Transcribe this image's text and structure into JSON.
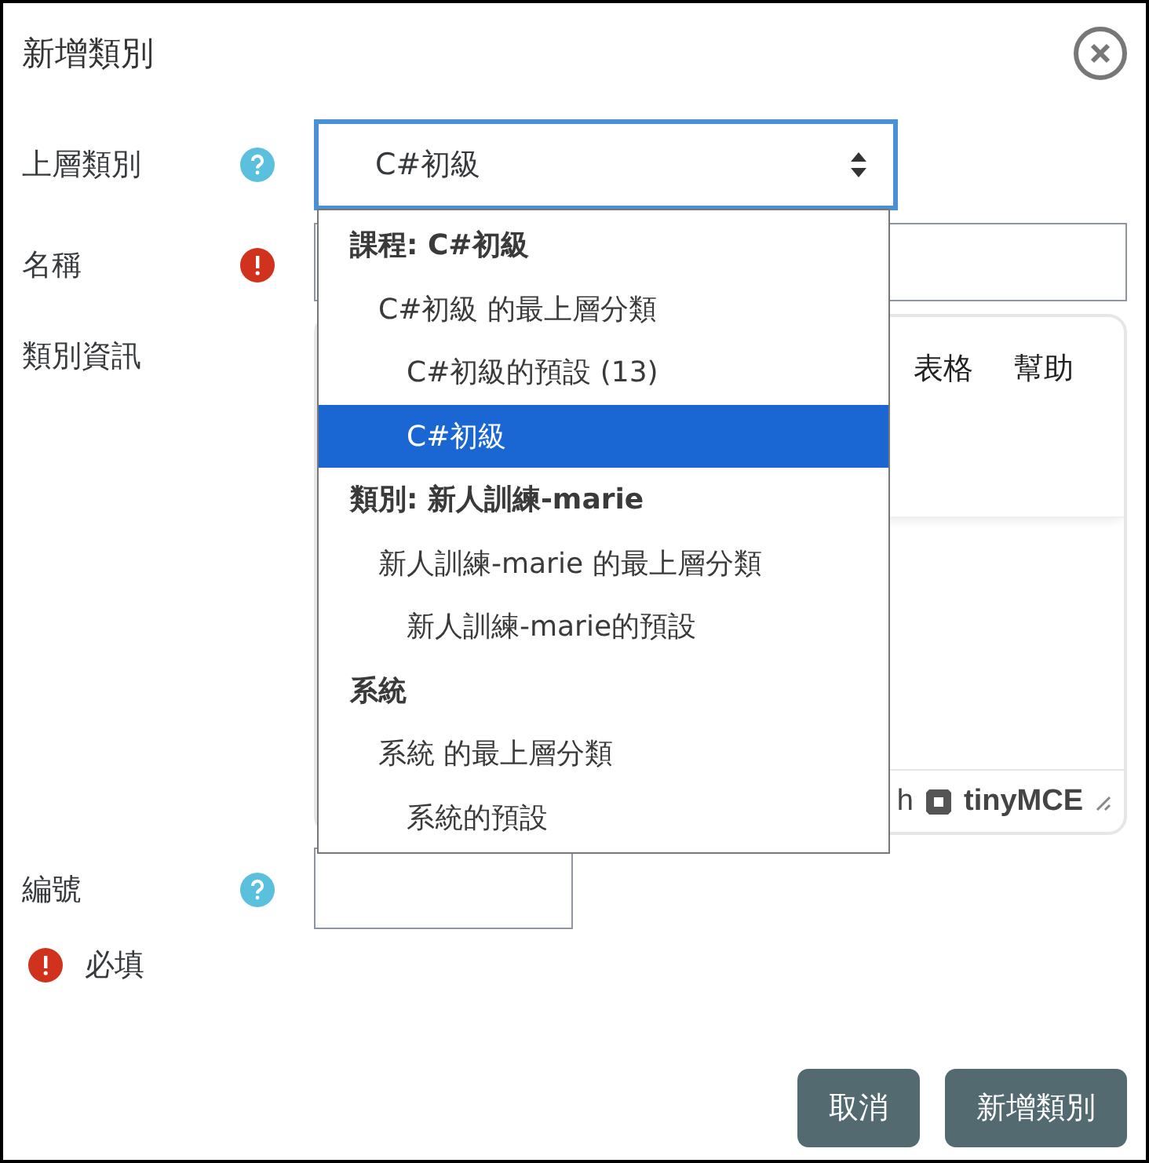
{
  "dialog": {
    "title": "新增類別"
  },
  "fields": [
    {
      "label": "上層類別",
      "hint": {
        "kind": "help"
      },
      "kind": "select",
      "value": "C#初級",
      "focused": true
    },
    {
      "label": "名稱",
      "hint": {
        "kind": "required"
      },
      "kind": "text"
    },
    {
      "label": "類別資訊",
      "kind": "editor"
    },
    {
      "label": "編號",
      "hint": {
        "kind": "help"
      },
      "kind": "number"
    }
  ],
  "editor": {
    "menu": [
      "表格",
      "幫助"
    ],
    "footer_text": "h",
    "brand": "tinyMCE"
  },
  "dropdown": {
    "options": [
      {
        "label": "課程: C#初級",
        "kind": "group",
        "children": [
          {
            "label": "C#初級 的最上層分類",
            "selected": false,
            "children": [
              {
                "label": "C#初級的預設 (13)",
                "selected": false
              },
              {
                "label": "C#初級",
                "selected": true
              }
            ]
          }
        ]
      },
      {
        "label": "類別: 新人訓練-marie",
        "kind": "group",
        "children": [
          {
            "label": "新人訓練-marie 的最上層分類",
            "selected": false,
            "children": [
              {
                "label": "新人訓練-marie的預設",
                "selected": false
              }
            ]
          }
        ]
      },
      {
        "label": "系統",
        "kind": "group",
        "children": [
          {
            "label": "系統 的最上層分類",
            "selected": false,
            "children": [
              {
                "label": "系統的預設",
                "selected": false
              }
            ]
          }
        ]
      }
    ]
  },
  "required_note": "必填",
  "buttons": [
    {
      "label": "取消"
    },
    {
      "label": "新增類別"
    }
  ]
}
